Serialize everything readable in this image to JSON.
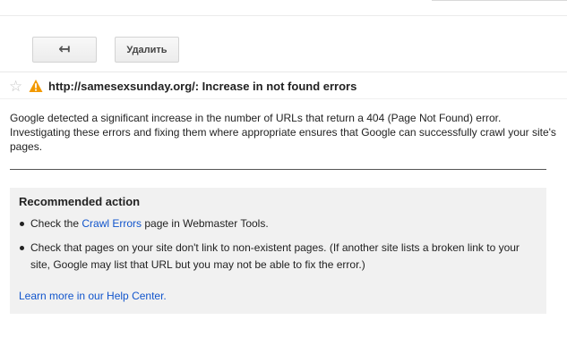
{
  "toolbar": {
    "back_icon": "reply-arrow-icon",
    "back_glyph": "↤",
    "delete_label": "Удалить"
  },
  "message": {
    "subject": "http://samesexsunday.org/: Increase in not found errors",
    "star_icon": "star-outline-icon",
    "star_glyph": "☆",
    "warning_icon": "warning-triangle-icon",
    "body": "Google detected a significant increase in the number of URLs that return a 404 (Page Not Found) error. Investigating these errors and fixing them where appropriate ensures that Google can successfully crawl your site's pages."
  },
  "recommended": {
    "title": "Recommended action",
    "item1_prefix": "Check the ",
    "item1_link": "Crawl Errors",
    "item1_suffix": " page in Webmaster Tools.",
    "item2": "Check that pages on your site don't link to non-existent pages. (If another site lists a broken link to your site, Google may list that URL but you may not be able to fix the error.)",
    "learn_more": "Learn more in our Help Center."
  },
  "colors": {
    "warning": "#f29900",
    "link": "#1155cc",
    "box_bg": "#f1f1f1"
  }
}
